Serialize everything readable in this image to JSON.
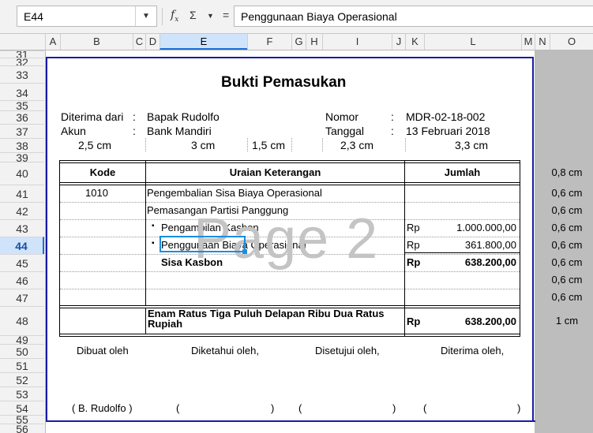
{
  "formula_bar": {
    "cell_ref": "E44",
    "fx_icon": "fx-icon",
    "sum_icon": "sigma-icon",
    "equals": "=",
    "content": "Penggunaan Biaya Operasional"
  },
  "columns": [
    "A",
    "B",
    "C",
    "D",
    "E",
    "F",
    "G",
    "H",
    "I",
    "J",
    "K",
    "L",
    "M",
    "N",
    "O"
  ],
  "rows": [
    "31",
    "32",
    "33",
    "34",
    "35",
    "36",
    "37",
    "38",
    "39",
    "40",
    "41",
    "42",
    "43",
    "44",
    "45",
    "46",
    "47",
    "48",
    "49",
    "50",
    "51",
    "52",
    "53",
    "54",
    "55",
    "56"
  ],
  "selected": {
    "column": "E",
    "row": "44"
  },
  "document": {
    "title": "Bukti Pemasukan",
    "received_from_label": "Diterima dari",
    "received_from": "Bapak Rudolfo",
    "account_label": "Akun",
    "account": "Bank Mandiri",
    "colon": ":",
    "number_label": "Nomor",
    "number": "MDR-02-18-002",
    "date_label": "Tanggal",
    "date": "13 Februari 2018",
    "widths": [
      "2,5 cm",
      "3 cm",
      "1,5 cm",
      "2,3 cm",
      "3,3 cm"
    ],
    "headers": {
      "code": "Kode",
      "description": "Uraian Keterangan",
      "amount": "Jumlah"
    },
    "lines": [
      {
        "code": "1010",
        "description": "Pengembalian Sisa Biaya Operasional",
        "currency": "",
        "amount": ""
      },
      {
        "code": "",
        "description": "Pemasangan Partisi Panggung",
        "currency": "",
        "amount": ""
      },
      {
        "code": "",
        "bullet": "▪",
        "description": "Pengambilan Kasbon",
        "currency": "Rp",
        "amount": "1.000.000,00"
      },
      {
        "code": "",
        "bullet": "▪",
        "description": "Penggunaan Biaya Operasional",
        "currency": "Rp",
        "amount": "361.800,00"
      },
      {
        "code": "",
        "description": "Sisa Kasbon",
        "currency": "Rp",
        "amount": "638.200,00"
      }
    ],
    "total_words": "Enam Ratus Tiga Puluh Delapan Ribu Dua Ratus Rupiah",
    "total_currency": "Rp",
    "total_amount": "638.200,00",
    "signatures": {
      "made_by": "Dibuat oleh",
      "known_by": "Diketahui oleh,",
      "approved_by": "Disetujui oleh,",
      "received_by": "Diterima oleh,",
      "name_made": "( B. Rudolfo )",
      "paren_open": "(",
      "paren_close": ")"
    },
    "row_heights": [
      "0,8 cm",
      "0,6 cm",
      "0,6 cm",
      "0,6 cm",
      "0,6 cm",
      "0,6 cm",
      "0,6 cm",
      "0,6 cm",
      "1 cm"
    ]
  },
  "watermark": "Page 2"
}
